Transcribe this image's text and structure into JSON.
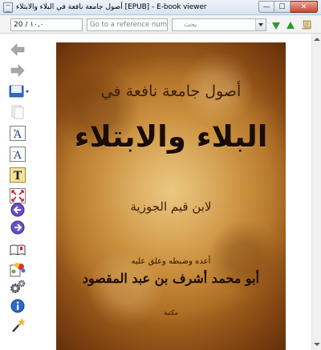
{
  "window": {
    "title": "أصول جامعة نافعة في البلاء والابتلاء [EPUB] - E-book viewer",
    "minimize_glyph": "—",
    "maximize_glyph": "☐",
    "close_glyph": "✕"
  },
  "toolbar": {
    "page_value": "20 / ١٠,٠",
    "reference_placeholder": "Go to a reference number...",
    "search_placeholder": "بحث",
    "find_next_icon": "green-down-arrow-icon",
    "find_previous_icon": "green-up-arrow-icon",
    "toc_icon": "scroll-icon"
  },
  "sidebar": {
    "buttons": [
      {
        "name": "back-button",
        "icon": "gray-left-arrow-icon"
      },
      {
        "name": "forward-button",
        "icon": "gray-right-arrow-icon"
      },
      {
        "name": "bookmarks-button",
        "icon": "bookmark-icon"
      },
      {
        "name": "copy-button",
        "icon": "copy-page-icon"
      },
      {
        "name": "font-larger-button",
        "icon": "font-size-increase-icon"
      },
      {
        "name": "font-smaller-button",
        "icon": "font-size-decrease-icon"
      },
      {
        "name": "font-button",
        "icon": "text-t-icon"
      },
      {
        "name": "fullscreen-button",
        "icon": "fullscreen-icon"
      },
      {
        "name": "previous-page-button",
        "icon": "purple-left-circle-icon"
      },
      {
        "name": "next-page-button",
        "icon": "purple-right-circle-icon"
      },
      {
        "name": "reference-mode-button",
        "icon": "book-icon"
      },
      {
        "name": "theme-button",
        "icon": "color-palette-icon"
      },
      {
        "name": "preferences-button",
        "icon": "gears-icon"
      },
      {
        "name": "metadata-button",
        "icon": "info-icon"
      },
      {
        "name": "inspector-button",
        "icon": "magic-wand-icon"
      }
    ],
    "labels": {
      "font_larger": "A",
      "font_smaller": "A",
      "font": "T",
      "info": "i"
    }
  },
  "book": {
    "subtitle": "أصول جامعة نافعة في",
    "title": "البلاء والابتلاء",
    "author": "لابن قيم الجوزية",
    "editor_label": "أعده وضبطه وعلق عليه",
    "editor": "أبو محمد أشرف بن عبد المقصود",
    "publisher": "مكتبة"
  }
}
